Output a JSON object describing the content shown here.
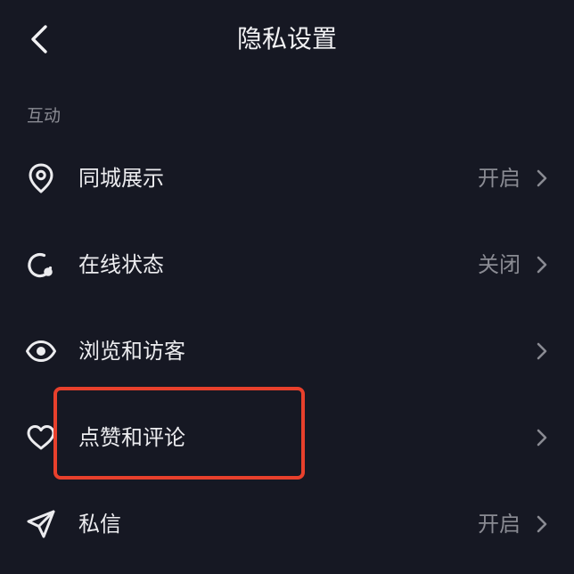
{
  "header": {
    "title": "隐私设置",
    "back_icon": "chevron-left-icon"
  },
  "section": {
    "title": "互动"
  },
  "rows": [
    {
      "icon": "location-pin-icon",
      "label": "同城展示",
      "value": "开启"
    },
    {
      "icon": "online-status-icon",
      "label": "在线状态",
      "value": "关闭"
    },
    {
      "icon": "eye-icon",
      "label": "浏览和访客",
      "value": ""
    },
    {
      "icon": "heart-icon",
      "label": "点赞和评论",
      "value": ""
    },
    {
      "icon": "paper-plane-icon",
      "label": "私信",
      "value": "开启"
    }
  ],
  "colors": {
    "background": "#161823",
    "text_primary": "#ececef",
    "text_secondary": "#8a8b93",
    "highlight": "#e8402c"
  }
}
